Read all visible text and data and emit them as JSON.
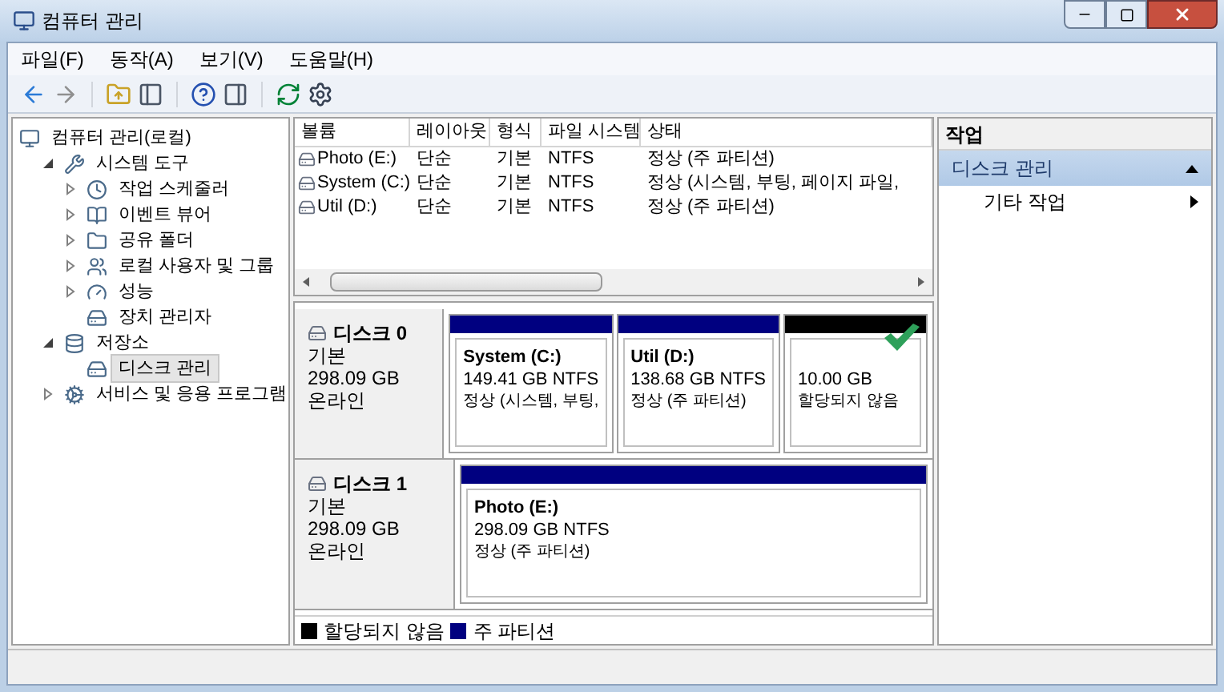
{
  "window": {
    "title": "컴퓨터 관리"
  },
  "menu": [
    "파일(F)",
    "동작(A)",
    "보기(V)",
    "도움말(H)"
  ],
  "tree": [
    {
      "label": "컴퓨터 관리(로컬)",
      "selected": false,
      "children": [
        {
          "label": "시스템 도구",
          "expanded": true,
          "selected": false,
          "children": [
            {
              "label": "작업 스케줄러",
              "expanded": false,
              "selected": false
            },
            {
              "label": "이벤트 뷰어",
              "expanded": false,
              "selected": false
            },
            {
              "label": "공유 폴더",
              "expanded": false,
              "selected": false
            },
            {
              "label": "로컬 사용자 및 그룹",
              "expanded": false,
              "selected": false
            },
            {
              "label": "성능",
              "expanded": false,
              "selected": false
            },
            {
              "label": "장치 관리자",
              "selected": false
            }
          ]
        },
        {
          "label": "저장소",
          "expanded": true,
          "selected": false,
          "children": [
            {
              "label": "디스크 관리",
              "selected": true
            }
          ]
        },
        {
          "label": "서비스 및 응용 프로그램",
          "expanded": false,
          "selected": false
        }
      ]
    }
  ],
  "volumes": {
    "columns": [
      "볼륨",
      "레이아웃",
      "형식",
      "파일 시스템",
      "상태"
    ],
    "rows": [
      [
        "Photo (E:)",
        "단순",
        "기본",
        "NTFS",
        "정상 (주 파티션)"
      ],
      [
        "System (C:)",
        "단순",
        "기본",
        "NTFS",
        "정상 (시스템, 부팅, 페이지 파일,"
      ],
      [
        "Util (D:)",
        "단순",
        "기본",
        "NTFS",
        "정상 (주 파티션)"
      ]
    ]
  },
  "disks": [
    {
      "name": "디스크 0",
      "type": "기본",
      "size": "298.09 GB",
      "status": "온라인",
      "partitions": [
        {
          "kind": "volume",
          "name": "System  (C:)",
          "detail": "149.41 GB NTFS",
          "status": "정상 (시스템, 부팅,",
          "color": "#000080"
        },
        {
          "kind": "volume",
          "name": "Util  (D:)",
          "detail": "138.68 GB NTFS",
          "status": "정상 (주 파티션)",
          "color": "#000080"
        },
        {
          "kind": "unallocated",
          "detail": "10.00 GB",
          "status": "할당되지 않음",
          "color": "#000000",
          "checked": true
        }
      ]
    },
    {
      "name": "디스크 1",
      "type": "기본",
      "size": "298.09 GB",
      "status": "온라인",
      "partitions": [
        {
          "kind": "volume",
          "name": "Photo  (E:)",
          "detail": "298.09 GB NTFS",
          "status": "정상 (주 파티션)",
          "color": "#000080"
        }
      ]
    }
  ],
  "legend": [
    {
      "label": "할당되지 않음",
      "color": "#000000"
    },
    {
      "label": "주 파티션",
      "color": "#000080"
    }
  ],
  "actions": {
    "header": "작업",
    "sections": [
      {
        "title": "디스크 관리",
        "expanded": true,
        "items": [
          "기타 작업"
        ]
      }
    ]
  }
}
